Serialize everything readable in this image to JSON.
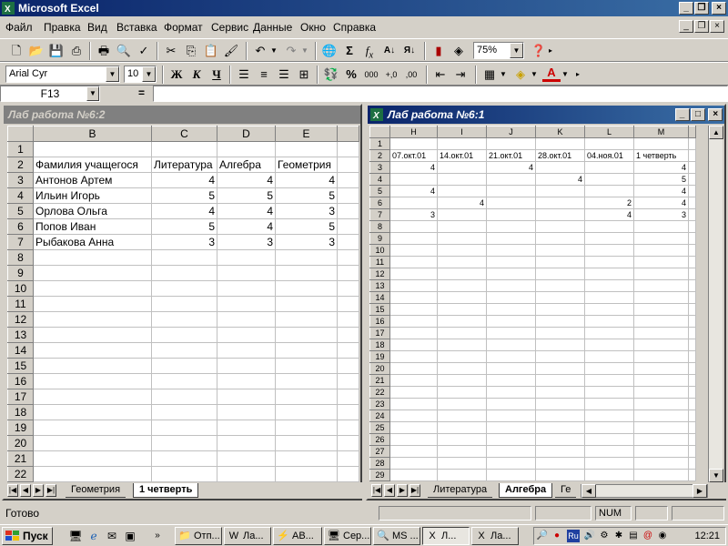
{
  "window": {
    "title": "Microsoft Excel"
  },
  "menu": [
    "Файл",
    "Правка",
    "Вид",
    "Вставка",
    "Формат",
    "Сервис",
    "Данные",
    "Окно",
    "Справка"
  ],
  "toolbar": {
    "zoom": "75%"
  },
  "format_toolbar": {
    "font": "Arial Cyr",
    "size": "10"
  },
  "formula": {
    "cell": "F13",
    "eq": "="
  },
  "wb1": {
    "title": "Лаб работа №6:2",
    "cols": [
      "B",
      "C",
      "D",
      "E"
    ],
    "rows": [
      [
        "",
        "",
        "",
        ""
      ],
      [
        "Фамилия учащегося",
        "Литература",
        "Алгебра",
        "Геометрия"
      ],
      [
        "Антонов Артем",
        "4",
        "4",
        "4"
      ],
      [
        "Ильин Игорь",
        "5",
        "5",
        "5"
      ],
      [
        "Орлова Ольга",
        "4",
        "4",
        "3"
      ],
      [
        "Попов Иван",
        "5",
        "4",
        "5"
      ],
      [
        "Рыбакова Анна",
        "3",
        "3",
        "3"
      ]
    ],
    "tabs": [
      "Геометрия",
      "1 четверть"
    ]
  },
  "wb2": {
    "title": "Лаб работа №6:1",
    "cols": [
      "H",
      "I",
      "J",
      "K",
      "L",
      "M"
    ],
    "rows": [
      [
        "",
        "",
        "",
        "",
        "",
        ""
      ],
      [
        "07.окт.01",
        "14.окт.01",
        "21.окт.01",
        "28.окт.01",
        "04.ноя.01",
        "1 четверть"
      ],
      [
        "4",
        "",
        "4",
        "",
        "",
        "4"
      ],
      [
        "",
        "",
        "",
        "4",
        "",
        "5"
      ],
      [
        "4",
        "",
        "",
        "",
        "",
        "4"
      ],
      [
        "",
        "4",
        "",
        "",
        "2",
        "4"
      ],
      [
        "3",
        "",
        "",
        "",
        "4",
        "3"
      ]
    ],
    "tabs": [
      "Литература",
      "Алгебра",
      "Ге"
    ]
  },
  "status": {
    "text": "Готово",
    "num": "NUM"
  },
  "taskbar": {
    "start": "Пуск",
    "buttons": [
      "Отп...",
      "Ла...",
      "AB...",
      "Сер...",
      "MS ...",
      "Л...",
      "Ла..."
    ],
    "lang": "Ru",
    "clock": "12:21"
  }
}
